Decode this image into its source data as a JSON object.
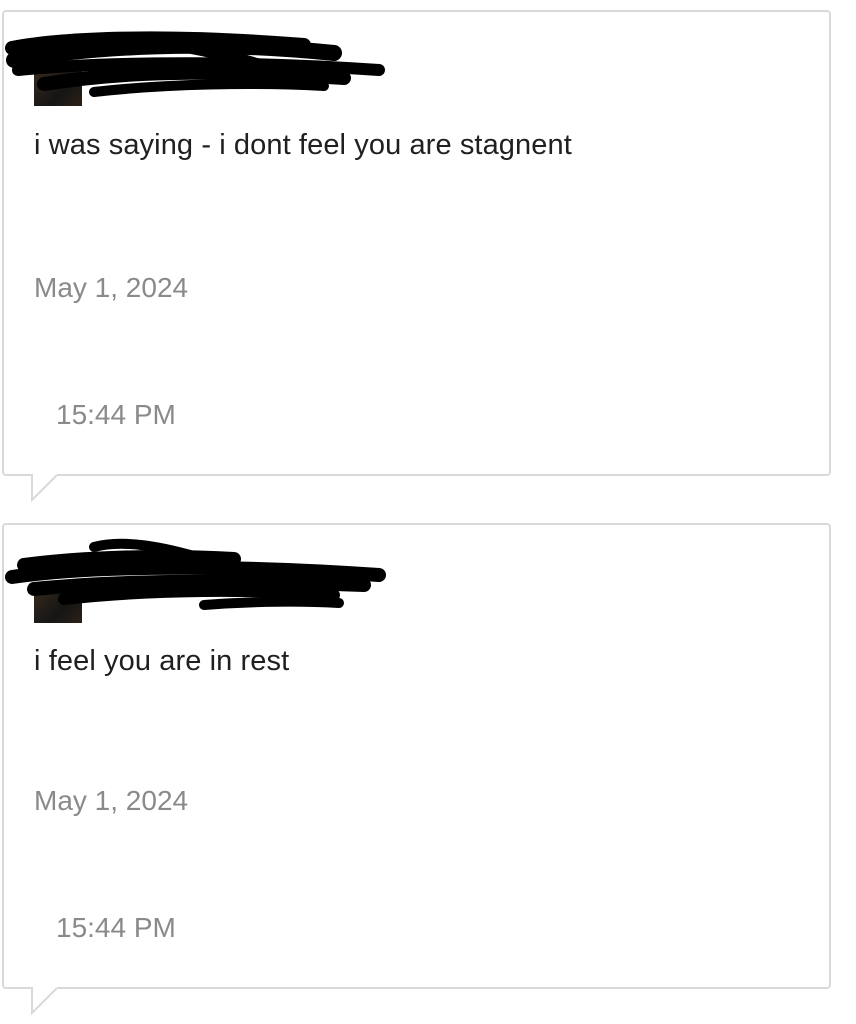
{
  "messages": [
    {
      "sender_name": "",
      "sender_redacted": true,
      "text": "i was saying - i dont feel you are stagnent",
      "date": "May 1, 2024",
      "time": "15:44 PM"
    },
    {
      "sender_name": "",
      "sender_redacted": true,
      "text": "i feel you are in rest",
      "date": "May 1, 2024",
      "time": "15:44 PM"
    }
  ],
  "colors": {
    "background": "#ffffff",
    "bubble_border": "#d9d9d9",
    "message_text": "#202020",
    "meta_text": "#8a8a8a",
    "redaction": "#000000"
  }
}
